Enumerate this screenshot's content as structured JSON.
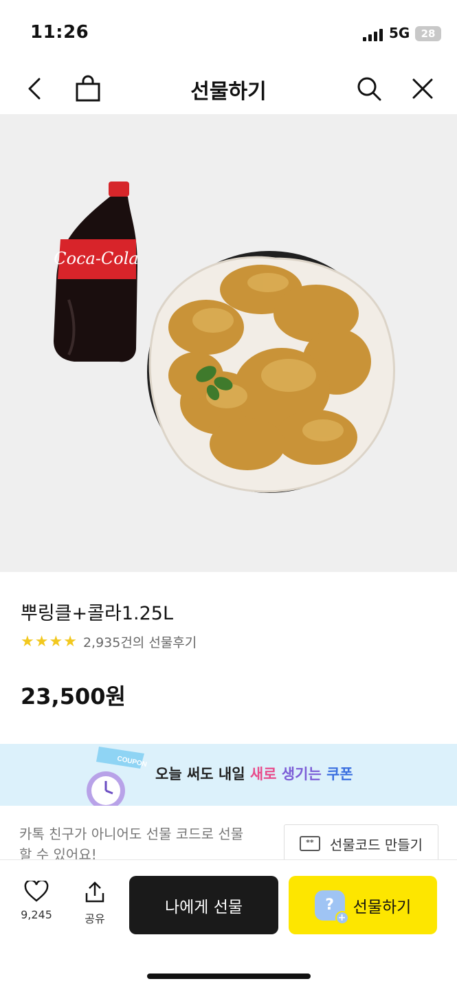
{
  "status_bar": {
    "time": "11:26",
    "network": "5G",
    "battery": "28"
  },
  "header": {
    "title": "선물하기",
    "icons": [
      "back-icon",
      "shopping-bag-icon",
      "search-icon",
      "close-icon"
    ]
  },
  "product": {
    "name": "뿌링클+콜라1.25L",
    "rating_stars": 4,
    "review_text": "2,935건의 선물후기",
    "price": "23,500원"
  },
  "coupon_banner": {
    "sticker_text": "COUPON",
    "text_plain": "오늘 써도 내일 ",
    "text_hl1": "새로",
    "text_hl2": " 생기는",
    "text_hl3": " 쿠폰",
    "colors": {
      "pink": "#e84c8b",
      "purple": "#7b5cd6",
      "blue": "#3a6fe0"
    }
  },
  "gift_code": {
    "description": "카톡 친구가 아니어도 선물 코드로 선물 할 수 있어요!",
    "button_label": "선물코드 만들기",
    "button_icon_text": "**"
  },
  "bottom_bar": {
    "like_count": "9,245",
    "share_label": "공유",
    "self_gift_label": "나에게 선물",
    "gift_label": "선물하기",
    "gift_avatar_text": "?",
    "gift_button_color": "#fde600"
  }
}
